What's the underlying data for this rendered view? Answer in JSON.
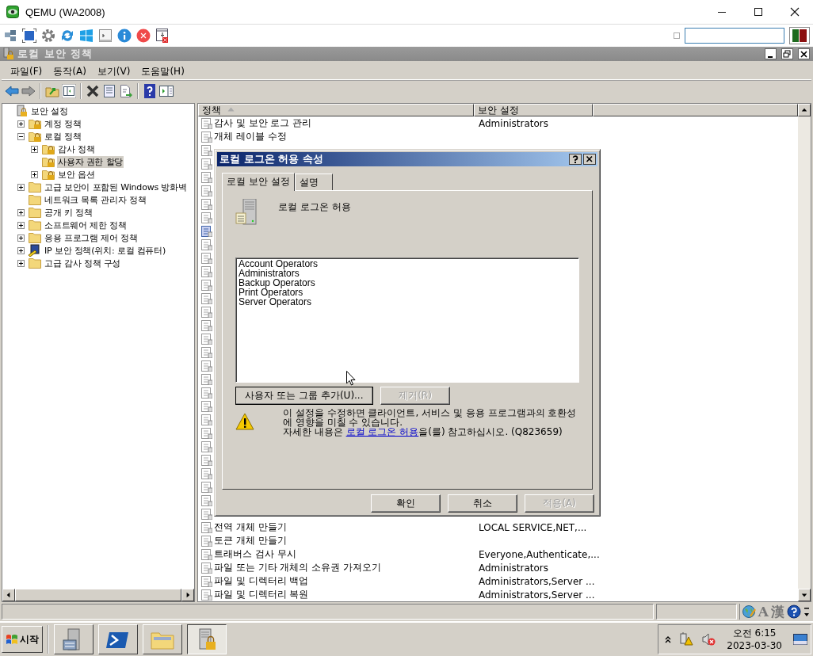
{
  "window": {
    "title": "QEMU (WA2008)"
  },
  "console": {
    "title": "로컬 보안 정책",
    "menu": [
      "파일(F)",
      "동작(A)",
      "보기(V)",
      "도움말(H)"
    ],
    "tree": [
      {
        "label": "보안 설정",
        "kind": "root",
        "selected": false,
        "children": [
          {
            "label": "계정 정책",
            "kind": "lockfolder",
            "expanded": false,
            "selected": false
          },
          {
            "label": "로컬 정책",
            "kind": "lockfolder",
            "expanded": true,
            "selected": false,
            "children": [
              {
                "label": "감사 정책",
                "kind": "lockfolder",
                "expanded": false,
                "selected": false
              },
              {
                "label": "사용자 권한 할당",
                "kind": "lockfolder",
                "selected": true
              },
              {
                "label": "보안 옵션",
                "kind": "lockfolder",
                "expanded": false,
                "selected": false
              }
            ]
          },
          {
            "label": "고급 보안이 포함된 Windows 방화벽",
            "kind": "folder",
            "expanded": false,
            "selected": false
          },
          {
            "label": "네트워크 목록 관리자 정책",
            "kind": "folder",
            "selected": false
          },
          {
            "label": "공개 키 정책",
            "kind": "folder",
            "expanded": false,
            "selected": false
          },
          {
            "label": "소프트웨어 제한 정책",
            "kind": "folder",
            "expanded": false,
            "selected": false
          },
          {
            "label": "응용 프로그램 제어 정책",
            "kind": "folder",
            "expanded": false,
            "selected": false
          },
          {
            "label": "IP 보안 정책(위치: 로컬 컴퓨터)",
            "kind": "ipsec",
            "expanded": false,
            "selected": false
          },
          {
            "label": "고급 감사 정책 구성",
            "kind": "folder",
            "expanded": false,
            "selected": false
          }
        ]
      }
    ],
    "columns": [
      {
        "label": "정책",
        "sorted": true
      },
      {
        "label": "보안 설정",
        "sorted": false
      }
    ],
    "rows": [
      {
        "kind": "policy",
        "name": "감사 및 보안 로그 관리",
        "setting": "Administrators",
        "selected": false
      },
      {
        "kind": "policy",
        "name": "개체 레이블 수정",
        "selected": false
      },
      {
        "kind": "covered",
        "selected": false
      },
      {
        "kind": "covered",
        "selected": false
      },
      {
        "kind": "covered",
        "selected": false
      },
      {
        "kind": "covered",
        "selected": false
      },
      {
        "kind": "covered",
        "selected": false
      },
      {
        "kind": "covered",
        "selected": false
      },
      {
        "kind": "covered",
        "selected": true
      },
      {
        "kind": "covered",
        "selected": false
      },
      {
        "kind": "covered",
        "selected": false
      },
      {
        "kind": "covered",
        "selected": false
      },
      {
        "kind": "covered",
        "selected": false
      },
      {
        "kind": "covered",
        "selected": false
      },
      {
        "kind": "covered",
        "selected": false
      },
      {
        "kind": "covered",
        "selected": false
      },
      {
        "kind": "covered",
        "selected": false
      },
      {
        "kind": "covered",
        "selected": false
      },
      {
        "kind": "covered",
        "selected": false
      },
      {
        "kind": "covered",
        "selected": false
      },
      {
        "kind": "covered",
        "selected": false
      },
      {
        "kind": "covered",
        "selected": false
      },
      {
        "kind": "covered",
        "selected": false
      },
      {
        "kind": "covered",
        "selected": false
      },
      {
        "kind": "covered",
        "selected": false
      },
      {
        "kind": "covered",
        "selected": false
      },
      {
        "kind": "covered",
        "selected": false
      },
      {
        "kind": "covered",
        "selected": false
      },
      {
        "kind": "covered",
        "selected": false
      },
      {
        "kind": "covered",
        "selected": false
      },
      {
        "kind": "policy",
        "name": "전역 개체 만들기",
        "setting": "LOCAL SERVICE,NET,...",
        "selected": false
      },
      {
        "kind": "policy",
        "name": "토큰 개체 만들기",
        "selected": false
      },
      {
        "kind": "policy",
        "name": "트래버스 검사 무시",
        "setting": "Everyone,Authenticate,...",
        "selected": false
      },
      {
        "kind": "policy",
        "name": "파일 또는 기타 개체의 소유권 가져오기",
        "setting": "Administrators",
        "selected": false
      },
      {
        "kind": "policy",
        "name": "파일 및 디렉터리 백업",
        "setting": "Administrators,Server ...",
        "selected": false
      },
      {
        "kind": "policy",
        "name": "파일 및 디렉터리 복원",
        "setting": "Administrators,Server ...",
        "selected": false
      }
    ],
    "language_bar": {
      "letter": "A",
      "hanja": "漢"
    }
  },
  "dialog": {
    "title": "로컬 로그온 허용 속성",
    "tabs": [
      {
        "label": "로컬 보안 설정",
        "selected": true
      },
      {
        "label": "설명",
        "selected": false
      }
    ],
    "policy_name": "로컬 로그온 허용",
    "members": [
      "Account Operators",
      "Administrators",
      "Backup Operators",
      "Print Operators",
      "Server Operators"
    ],
    "list_buttons": [
      {
        "label": "사용자 또는 그룹 추가(U)...",
        "disabled": false
      },
      {
        "label": "제거(R)",
        "disabled": true
      }
    ],
    "warning": "이 설정을 수정하면 클라이언트, 서비스 및 응용 프로그램과의 호환성에 영향을 미칠 수 있습니다.",
    "more_info": {
      "before": "자세한 내용은 ",
      "link": "로컬 로그온 허용",
      "after": "을(를) 참고하십시오. (Q823659)"
    },
    "buttons": [
      {
        "label": "확인",
        "disabled": false
      },
      {
        "label": "취소",
        "disabled": false
      },
      {
        "label": "적용(A)",
        "disabled": true
      }
    ]
  },
  "taskbar": {
    "start": "시작",
    "apps": [
      {
        "kind": "server",
        "selected": false
      },
      {
        "kind": "shell",
        "selected": false
      },
      {
        "kind": "explorer",
        "selected": false
      },
      {
        "kind": "policy",
        "selected": true
      }
    ],
    "time": "오전 6:15",
    "date": "2023-03-30"
  }
}
